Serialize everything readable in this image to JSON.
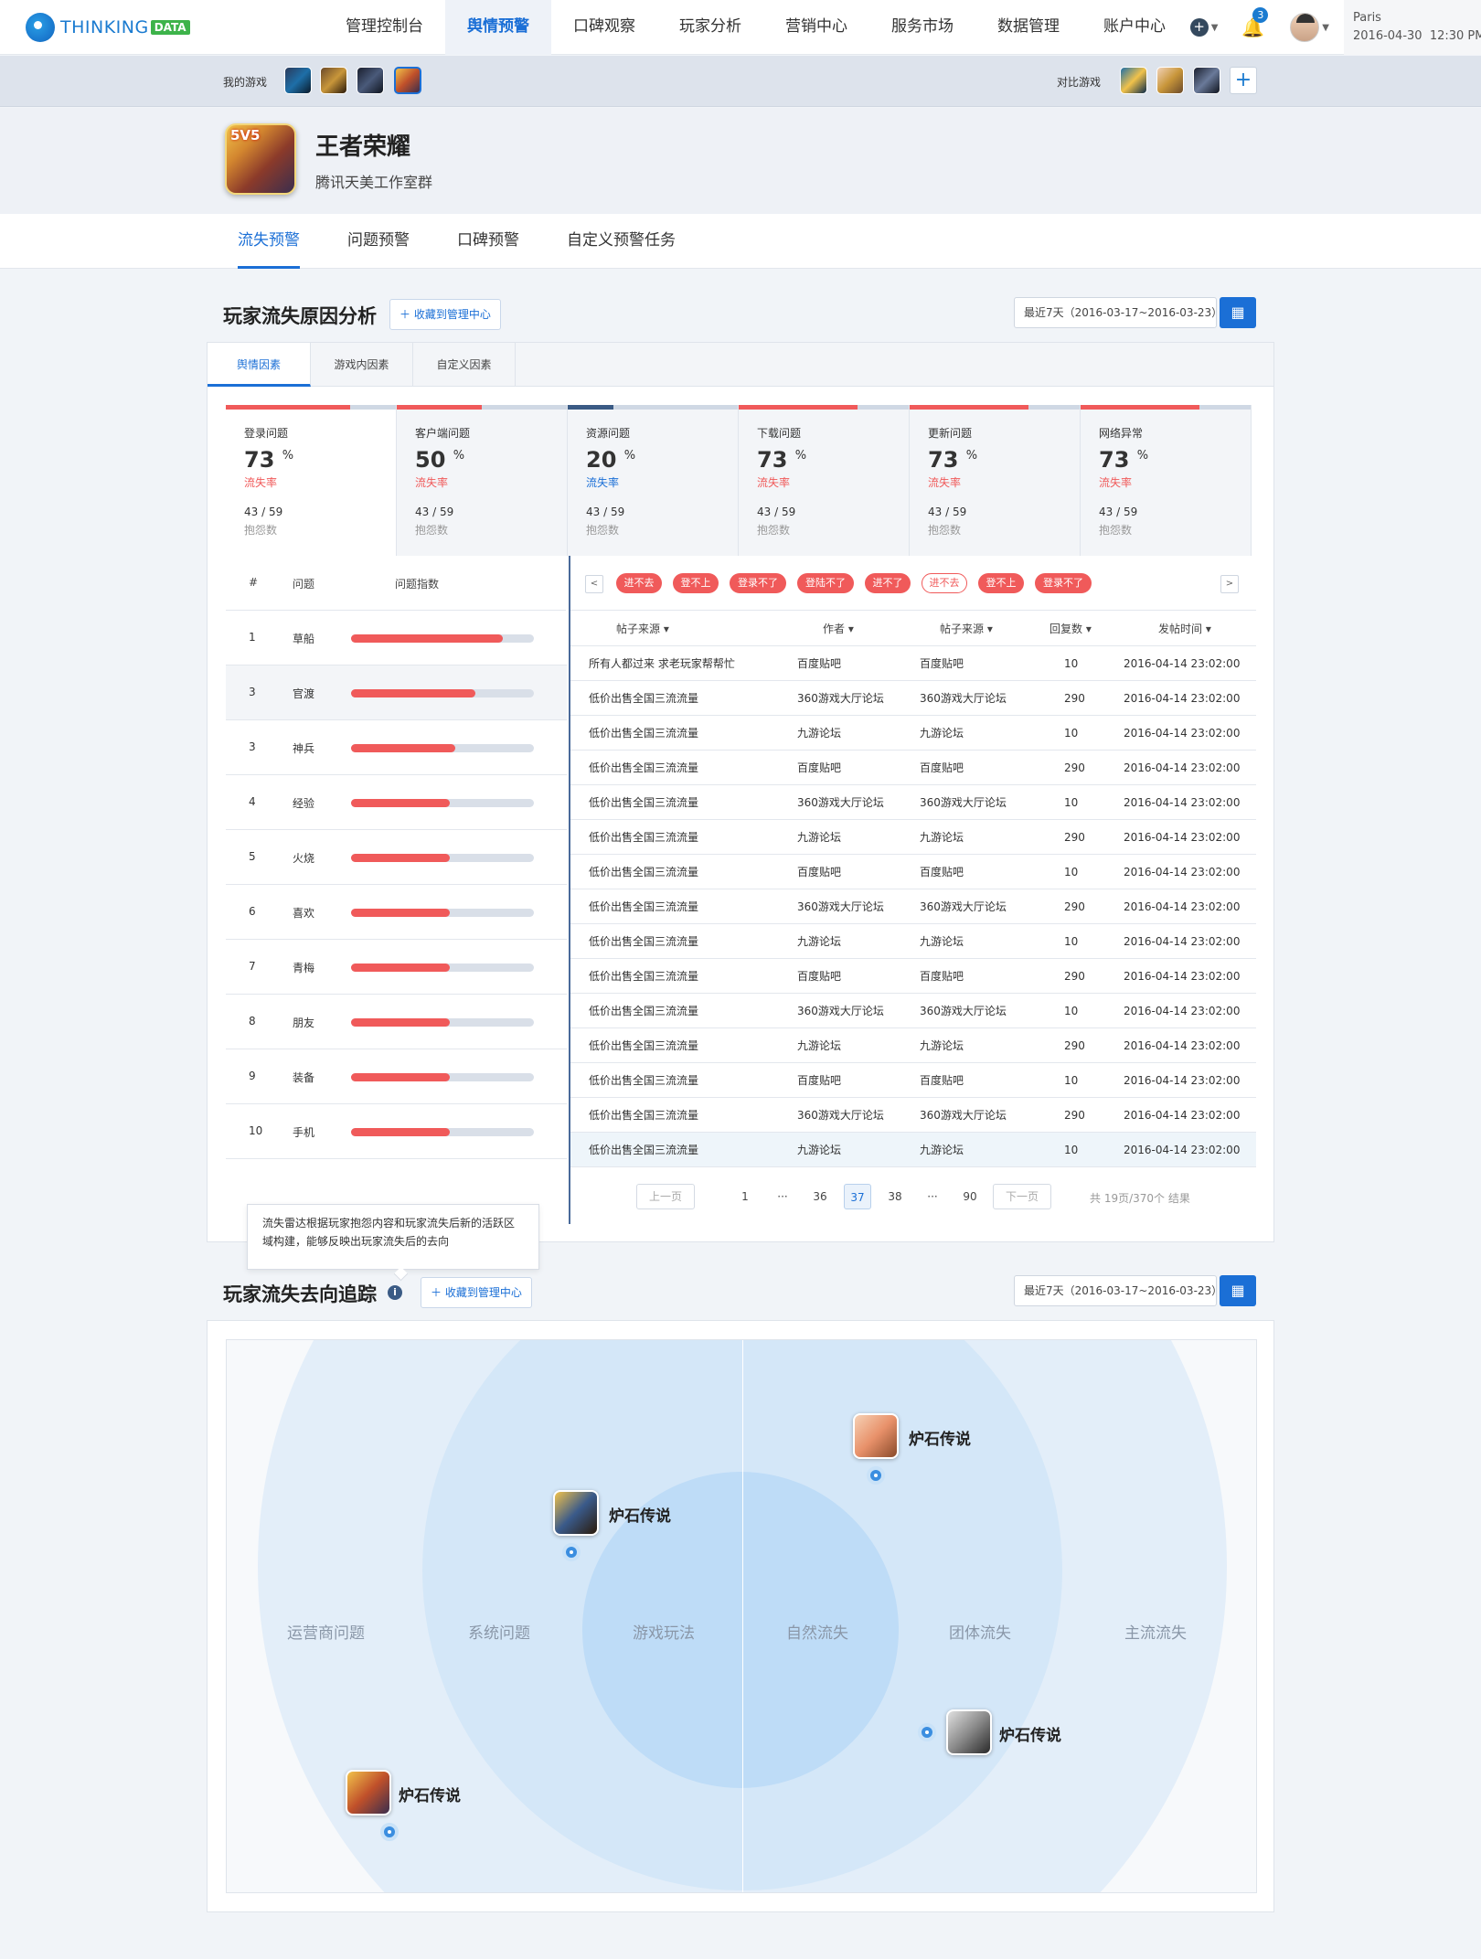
{
  "brand": {
    "text": "THINKING",
    "badge": "DATA"
  },
  "nav": [
    "管理控制台",
    "舆情预警",
    "口碑观察",
    "玩家分析",
    "营销中心",
    "服务市场",
    "数据管理",
    "账户中心"
  ],
  "nav_active": "舆情预警",
  "user": {
    "notifications": "3",
    "city": "Paris",
    "datetime": "2016-04-30  12:30 PM"
  },
  "my_games_label": "我的游戏",
  "compare_label": "对比游戏",
  "game": {
    "name": "王者荣耀",
    "studio": "腾讯天美工作室群",
    "icon_badge": "5V5"
  },
  "subnav": [
    "流失预警",
    "问题预警",
    "口碑预警",
    "自定义预警任务"
  ],
  "section1": {
    "title": "玩家流失原因分析",
    "fav": "收藏到管理中心",
    "date": "最近7天（2016-03-17~2016-03-23）"
  },
  "tabs": [
    "舆情因素",
    "游戏内因素",
    "自定义因素"
  ],
  "metrics": [
    {
      "name": "登录问题",
      "pct": "73",
      "unit": "%",
      "label": "流失率",
      "count": "43 / 59",
      "sub": "抱怨数",
      "fill": 0.73,
      "color": "#f05a5a"
    },
    {
      "name": "客户端问题",
      "pct": "50",
      "unit": "%",
      "label": "流失率",
      "count": "43 / 59",
      "sub": "抱怨数",
      "fill": 0.5,
      "color": "#f05a5a"
    },
    {
      "name": "资源问题",
      "pct": "20",
      "unit": "%",
      "label": "流失率",
      "count": "43 / 59",
      "sub": "抱怨数",
      "fill": 0.27,
      "color": "#3b5b85"
    },
    {
      "name": "下载问题",
      "pct": "73",
      "unit": "%",
      "label": "流失率",
      "count": "43 / 59",
      "sub": "抱怨数",
      "fill": 0.7,
      "color": "#f05a5a"
    },
    {
      "name": "更新问题",
      "pct": "73",
      "unit": "%",
      "label": "流失率",
      "count": "43 / 59",
      "sub": "抱怨数",
      "fill": 0.7,
      "color": "#f05a5a"
    },
    {
      "name": "网络异常",
      "pct": "73",
      "unit": "%",
      "label": "流失率",
      "count": "43 / 59",
      "sub": "抱怨数",
      "fill": 0.7,
      "color": "#f05a5a"
    }
  ],
  "left_table": {
    "headers": [
      "#",
      "问题",
      "问题指数"
    ],
    "rows": [
      {
        "n": "1",
        "w": "草船",
        "v": 0.83
      },
      {
        "n": "3",
        "w": "官渡",
        "v": 0.68
      },
      {
        "n": "3",
        "w": "神兵",
        "v": 0.57
      },
      {
        "n": "4",
        "w": "经验",
        "v": 0.54
      },
      {
        "n": "5",
        "w": "火烧",
        "v": 0.54
      },
      {
        "n": "6",
        "w": "喜欢",
        "v": 0.54
      },
      {
        "n": "7",
        "w": "青梅",
        "v": 0.54
      },
      {
        "n": "8",
        "w": "朋友",
        "v": 0.54
      },
      {
        "n": "9",
        "w": "装备",
        "v": 0.54
      },
      {
        "n": "10",
        "w": "手机",
        "v": 0.54
      }
    ]
  },
  "tags": [
    "进不去",
    "登不上",
    "登录不了",
    "登陆不了",
    "进不了",
    "进不去",
    "登不上",
    "登录不了"
  ],
  "right_table": {
    "headers": [
      "帖子来源",
      "作者",
      "帖子来源",
      "回复数",
      "发帖时间"
    ],
    "rows": [
      [
        "所有人都过来 求老玩家帮帮忙",
        "百度贴吧",
        "百度贴吧",
        "10",
        "2016-04-14 23:02:00"
      ],
      [
        "低价出售全国三流流量",
        "360游戏大厅论坛",
        "360游戏大厅论坛",
        "290",
        "2016-04-14 23:02:00"
      ],
      [
        "低价出售全国三流流量",
        "九游论坛",
        "九游论坛",
        "10",
        "2016-04-14 23:02:00"
      ],
      [
        "低价出售全国三流流量",
        "百度贴吧",
        "百度贴吧",
        "290",
        "2016-04-14 23:02:00"
      ],
      [
        "低价出售全国三流流量",
        "360游戏大厅论坛",
        "360游戏大厅论坛",
        "10",
        "2016-04-14 23:02:00"
      ],
      [
        "低价出售全国三流流量",
        "九游论坛",
        "九游论坛",
        "290",
        "2016-04-14 23:02:00"
      ],
      [
        "低价出售全国三流流量",
        "百度贴吧",
        "百度贴吧",
        "10",
        "2016-04-14 23:02:00"
      ],
      [
        "低价出售全国三流流量",
        "360游戏大厅论坛",
        "360游戏大厅论坛",
        "290",
        "2016-04-14 23:02:00"
      ],
      [
        "低价出售全国三流流量",
        "九游论坛",
        "九游论坛",
        "10",
        "2016-04-14 23:02:00"
      ],
      [
        "低价出售全国三流流量",
        "百度贴吧",
        "百度贴吧",
        "290",
        "2016-04-14 23:02:00"
      ],
      [
        "低价出售全国三流流量",
        "360游戏大厅论坛",
        "360游戏大厅论坛",
        "10",
        "2016-04-14 23:02:00"
      ],
      [
        "低价出售全国三流流量",
        "九游论坛",
        "九游论坛",
        "290",
        "2016-04-14 23:02:00"
      ],
      [
        "低价出售全国三流流量",
        "百度贴吧",
        "百度贴吧",
        "10",
        "2016-04-14 23:02:00"
      ],
      [
        "低价出售全国三流流量",
        "360游戏大厅论坛",
        "360游戏大厅论坛",
        "290",
        "2016-04-14 23:02:00"
      ],
      [
        "低价出售全国三流流量",
        "九游论坛",
        "九游论坛",
        "10",
        "2016-04-14 23:02:00"
      ]
    ]
  },
  "pager": {
    "prev": "上一页",
    "next": "下一页",
    "pages": [
      "1",
      "···",
      "36",
      "37",
      "38",
      "···",
      "90"
    ],
    "current": "37",
    "summary": "共 19页/370个 结果"
  },
  "tooltip": "流失雷达根据玩家抱怨内容和玩家流失后新的活跃区域构建，能够反映出玩家流失后的去向",
  "section2": {
    "title": "玩家流失去向追踪",
    "info": "i",
    "fav": "收藏到管理中心",
    "date": "最近7天（2016-03-17~2016-03-23）"
  },
  "radar": {
    "labels": [
      "运营商问题",
      "系统问题",
      "游戏玩法",
      "自然流失",
      "团体流失",
      "主流流失"
    ],
    "games": [
      "炉石传说",
      "炉石传说",
      "炉石传说",
      "炉石传说"
    ]
  },
  "colors": {
    "accent": "#1b6fd6",
    "danger": "#f05a5a"
  }
}
